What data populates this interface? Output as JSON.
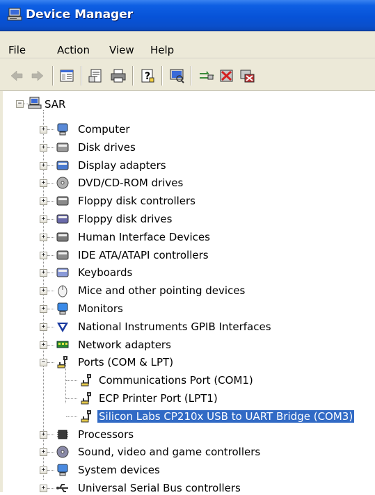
{
  "window": {
    "title": "Device Manager"
  },
  "menu": {
    "file": "File",
    "action": "Action",
    "view": "View",
    "help": "Help"
  },
  "toolbar": {
    "buttons": [
      "back-arrow-icon",
      "forward-arrow-icon",
      "show-hide-tree-icon",
      "properties-icon",
      "print-icon",
      "help-icon",
      "scan-hardware-icon",
      "update-driver-icon",
      "disable-device-icon",
      "uninstall-device-icon"
    ]
  },
  "tree": {
    "root": "SAR",
    "items": [
      {
        "label": "Computer",
        "icon": "computer-icon"
      },
      {
        "label": "Disk drives",
        "icon": "disk-drive-icon"
      },
      {
        "label": "Display adapters",
        "icon": "display-adapter-icon"
      },
      {
        "label": "DVD/CD-ROM drives",
        "icon": "cd-drive-icon"
      },
      {
        "label": "Floppy disk controllers",
        "icon": "floppy-controller-icon"
      },
      {
        "label": "Floppy disk drives",
        "icon": "floppy-drive-icon"
      },
      {
        "label": "Human Interface Devices",
        "icon": "hid-icon"
      },
      {
        "label": "IDE ATA/ATAPI controllers",
        "icon": "ide-controller-icon"
      },
      {
        "label": "Keyboards",
        "icon": "keyboard-icon"
      },
      {
        "label": "Mice and other pointing devices",
        "icon": "mouse-icon"
      },
      {
        "label": "Monitors",
        "icon": "monitor-icon"
      },
      {
        "label": "National Instruments GPIB Interfaces",
        "icon": "ni-gpib-icon"
      },
      {
        "label": "Network adapters",
        "icon": "network-adapter-icon"
      },
      {
        "label": "Ports (COM & LPT)",
        "icon": "port-icon"
      },
      {
        "label": "Processors",
        "icon": "processor-icon"
      },
      {
        "label": "Sound, video and game controllers",
        "icon": "sound-icon"
      },
      {
        "label": "System devices",
        "icon": "system-device-icon"
      },
      {
        "label": "Universal Serial Bus controllers",
        "icon": "usb-icon"
      }
    ],
    "ports_children": [
      {
        "label": "Communications Port (COM1)",
        "icon": "port-icon"
      },
      {
        "label": "ECP Printer Port (LPT1)",
        "icon": "port-icon"
      },
      {
        "label": "Silicon Labs CP210x USB to UART Bridge (COM3)",
        "icon": "port-icon",
        "selected": true
      }
    ]
  },
  "colors": {
    "title_bar": "#0753d8",
    "chrome": "#ece9d8",
    "selection": "#316ac5"
  }
}
